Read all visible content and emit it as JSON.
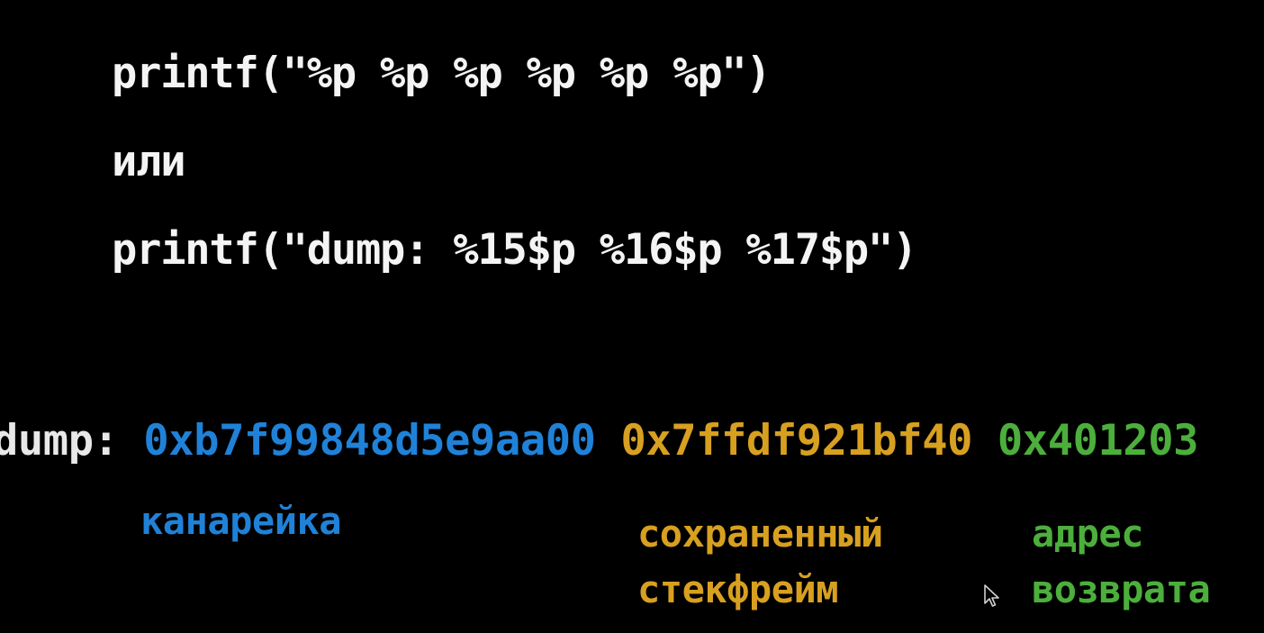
{
  "code_lines": {
    "line1": "printf(\"%p %p %p %p %p %p\")",
    "line2": "или",
    "line3": "printf(\"dump: %15$p %16$p %17$p\")"
  },
  "dump": {
    "prefix": "dump: ",
    "canary_value": "0xb7f99848d5e9aa00",
    "frame_value": "0x7ffdf921bf40",
    "ret_value": "0x401203"
  },
  "labels": {
    "canary": "канарейка",
    "frame": "сохраненный\nстекфрейм",
    "ret": "адрес\nвозврата"
  },
  "colors": {
    "canary": "#1f82d8",
    "frame": "#d8a020",
    "ret": "#4caf3c",
    "text": "#f4f4f4",
    "background": "#000000"
  },
  "icons": {
    "cursor": "mouse-pointer-icon"
  }
}
